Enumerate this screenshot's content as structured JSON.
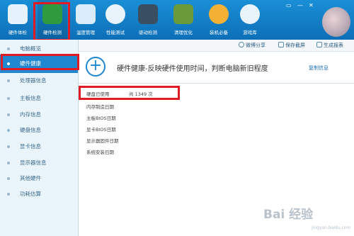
{
  "toolbar": {
    "items": [
      {
        "label": "硬件体检",
        "icon": "monitor-icon"
      },
      {
        "label": "硬件检测",
        "icon": "chip-icon"
      },
      {
        "label": "温度管理",
        "icon": "thermometer-chart-icon"
      },
      {
        "label": "性能测试",
        "icon": "speedometer-icon"
      },
      {
        "label": "驱动检测",
        "icon": "gear-box-icon"
      },
      {
        "label": "清理优化",
        "icon": "broom-icon"
      },
      {
        "label": "装机必备",
        "icon": "palette-icon"
      },
      {
        "label": "游戏库",
        "icon": "gamepad-icon"
      }
    ],
    "active_index": 1,
    "window_controls": [
      "▭",
      "—",
      "✕"
    ]
  },
  "sidebar": {
    "items": [
      {
        "label": "电脑概览"
      },
      {
        "label": "硬件健康"
      },
      {
        "label": "处理器信息"
      },
      {
        "label": "主板信息"
      },
      {
        "label": "内存信息"
      },
      {
        "label": "硬盘信息"
      },
      {
        "label": "显卡信息"
      },
      {
        "label": "显示器信息"
      },
      {
        "label": "其他硬件"
      },
      {
        "label": "功耗估算"
      }
    ],
    "active_index": 1
  },
  "subbar": {
    "share_label": "微博分享",
    "save_label": "保存截屏",
    "report_label": "生成报表"
  },
  "main": {
    "headline": "硬件健康-反映硬件使用时间，判断电脑新旧程度",
    "copy_label": "复制信息",
    "rows": [
      {
        "label": "硬盘已使用",
        "value": "共 1349 次"
      },
      {
        "label": "内存制造日期",
        "value": ""
      },
      {
        "label": "主板BIOS日期",
        "value": ""
      },
      {
        "label": "显卡BIOS日期",
        "value": ""
      },
      {
        "label": "显示器固件日期",
        "value": ""
      },
      {
        "label": "系统安装日期",
        "value": ""
      }
    ]
  },
  "watermark": {
    "text": "Bai 经验",
    "sub": "jingyan.baidu.com"
  },
  "colors": {
    "accent": "#1f88d0",
    "highlight": "#e01b24",
    "topbar": "#1a8fd6"
  }
}
